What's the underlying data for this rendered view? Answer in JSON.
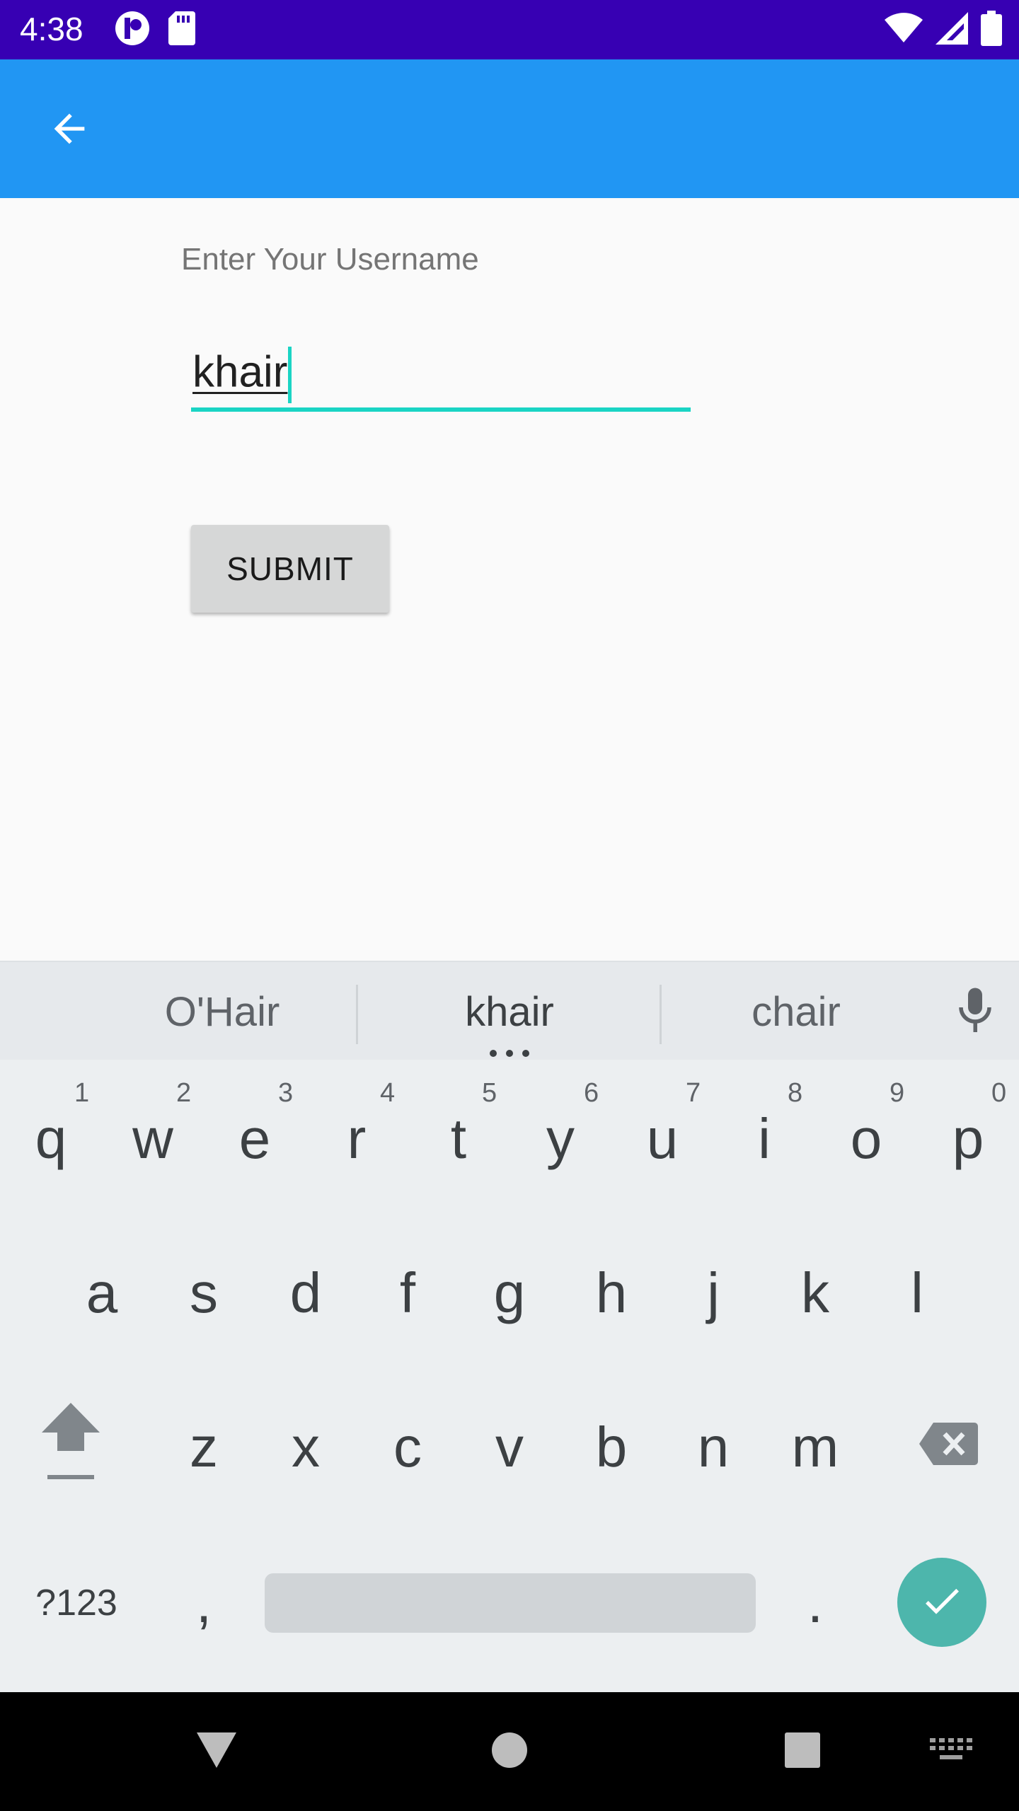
{
  "status_bar": {
    "time": "4:38",
    "left_icons": [
      "app-notification-icon",
      "sd-card-icon"
    ],
    "right_icons": [
      "wifi-icon",
      "cell-signal-icon",
      "battery-icon"
    ],
    "background": "#3700b3"
  },
  "app_bar": {
    "back_icon": "arrow-back-icon",
    "background": "#2196f3"
  },
  "form": {
    "prompt": "Enter Your Username",
    "username_value": "khair",
    "submit_label": "SUBMIT",
    "accent": "#1ad4c4"
  },
  "keyboard": {
    "suggestions": [
      "O'Hair",
      "khair",
      "chair"
    ],
    "row1": [
      "q",
      "w",
      "e",
      "r",
      "t",
      "y",
      "u",
      "i",
      "o",
      "p"
    ],
    "row1_hints": [
      "1",
      "2",
      "3",
      "4",
      "5",
      "6",
      "7",
      "8",
      "9",
      "0"
    ],
    "row2": [
      "a",
      "s",
      "d",
      "f",
      "g",
      "h",
      "j",
      "k",
      "l"
    ],
    "row3": [
      "z",
      "x",
      "c",
      "v",
      "b",
      "n",
      "m"
    ],
    "symbols_label": "?123",
    "comma": ",",
    "period": ".",
    "shift_icon": "shift-icon",
    "backspace_icon": "backspace-icon",
    "enter_icon": "check-icon",
    "mic_icon": "microphone-icon",
    "enter_color": "#4db6ac"
  },
  "nav_bar": {
    "icons": [
      "back-triangle-icon",
      "home-circle-icon",
      "recents-square-icon",
      "keyboard-switch-icon"
    ]
  }
}
